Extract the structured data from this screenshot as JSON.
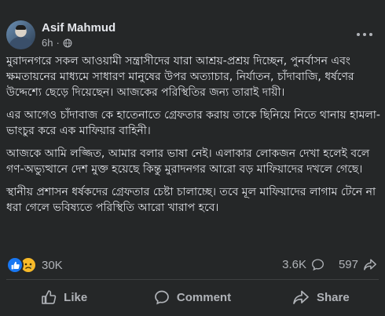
{
  "post": {
    "author": "Asif Mahmud",
    "time": "6h",
    "dot": "·",
    "paragraphs": [
      "মুরাদনগরে সকল আওয়ামী সন্ত্রাসীদের যারা আশ্রয়-প্রশ্রয় দিচ্ছেন, পুনর্বাসন এবং ক্ষমতায়নের মাধ্যমে সাধারণ মানুষের উপর অত্যাচার, নির্যাতন, চাঁদাবাজি, ধর্ষণের উদ্দেশ্যে ছেড়ে দিয়েছেন। আজকের পরিস্থিতির জন্য তারাই দায়ী।",
      "এর আগেও চাঁদাবাজ কে হাতেনাতে গ্রেফতার করায় তাকে ছিনিয়ে নিতে থানায় হামলা-ভাংচুর করে এক মাফিয়ার বাহিনী।",
      "আজকে আমি লজ্জিত, আমার বলার ভাষা নেই। এলাকার লোকজন দেখা হলেই বলে গণ-অভ্যুত্থানে দেশ মুক্ত হয়েছে কিন্তু মুরাদনগর আরো বড় মাফিয়াদের দখলে গেছে।",
      "স্থানীয় প্রশাসন ধর্ষকদের গ্রেফতার চেষ্টা চালাচ্ছে। তবে মূল মাফিয়াদের লাগাম টেনে না ধরা গেলে ভবিষ্যতে পরিস্থিতি আরো খারাপ হবে।"
    ]
  },
  "stats": {
    "reactions": "30K",
    "comments": "3.6K",
    "shares": "597"
  },
  "actions": {
    "like": "Like",
    "comment": "Comment",
    "share": "Share"
  },
  "colors": {
    "background": "#252728",
    "text": "#e4e6eb",
    "secondary": "#b0b3b8",
    "like_blue": "#1877f2",
    "sad_yellow": "#f7b928"
  }
}
